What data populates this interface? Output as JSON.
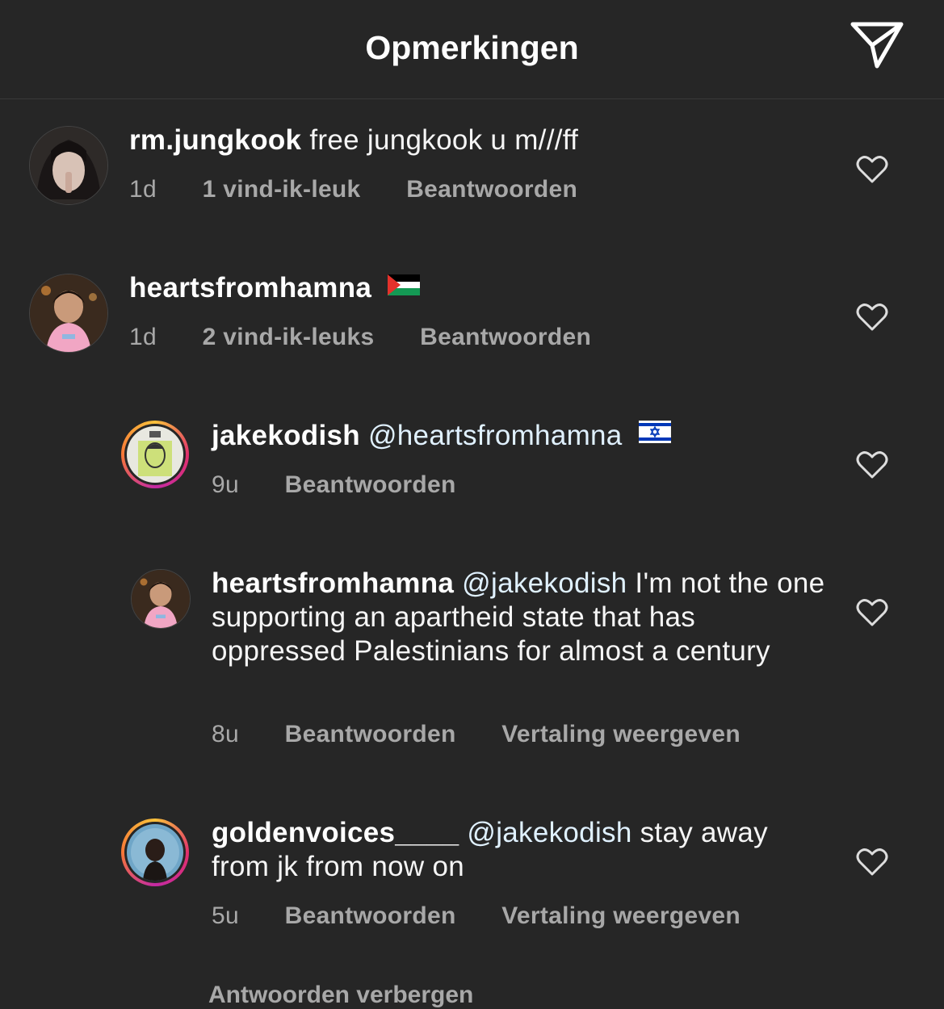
{
  "header": {
    "title": "Opmerkingen",
    "send_icon": "paper-plane-icon"
  },
  "comments": [
    {
      "username": "rm.jungkook",
      "text": "free jungkook u m///ff",
      "time": "1d",
      "likes": "1 vind-ik-leuk",
      "reply": "Beantwoorden"
    },
    {
      "username": "heartsfromhamna",
      "text": "",
      "flag": "Palestine flag",
      "time": "1d",
      "likes": "2 vind-ik-leuks",
      "reply": "Beantwoorden"
    }
  ],
  "replies": [
    {
      "username": "jakekodish",
      "mention": "@heartsfromhamna",
      "text": "",
      "flag": "Israel flag",
      "time": "9u",
      "reply": "Beantwoorden"
    },
    {
      "username": "heartsfromhamna",
      "mention": "@jakekodish",
      "text": "I'm not the one supporting an apartheid state that has oppressed Palestinians for almost a century",
      "time": "8u",
      "reply": "Beantwoorden",
      "translate": "Vertaling weergeven"
    },
    {
      "username": "goldenvoices____",
      "mention": "@jakekodish",
      "text": "stay away from jk from now on",
      "time": "5u",
      "reply": "Beantwoorden",
      "translate": "Vertaling weergeven"
    }
  ],
  "footer": {
    "hide_replies": "Antwoorden verbergen"
  },
  "colors": {
    "background": "#262626",
    "secondary_text": "#a8a8a8",
    "mention": "#e0f1ff"
  }
}
